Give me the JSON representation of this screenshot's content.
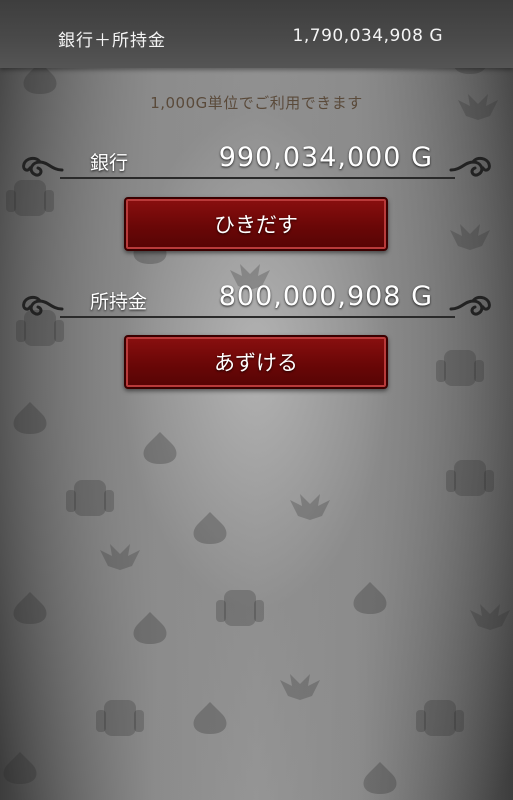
{
  "header": {
    "label": "銀行＋所持金",
    "value": "1,790,034,908 G"
  },
  "note": "1,000G単位でご利用できます",
  "bank": {
    "label": "銀行",
    "value": "990,034,000 G",
    "button_label": "ひきだす"
  },
  "wallet": {
    "label": "所持金",
    "value": "800,000,908 G",
    "button_label": "あずける"
  },
  "colors": {
    "button_red": "#6a0707",
    "background_gray": "#8a8a8a",
    "header_dark": "#444444",
    "note_brown": "#5a4a3a"
  },
  "icons": [
    "slime-pattern-icon",
    "golem-pattern-icon",
    "dracky-pattern-icon",
    "scroll-ornament-icon"
  ]
}
